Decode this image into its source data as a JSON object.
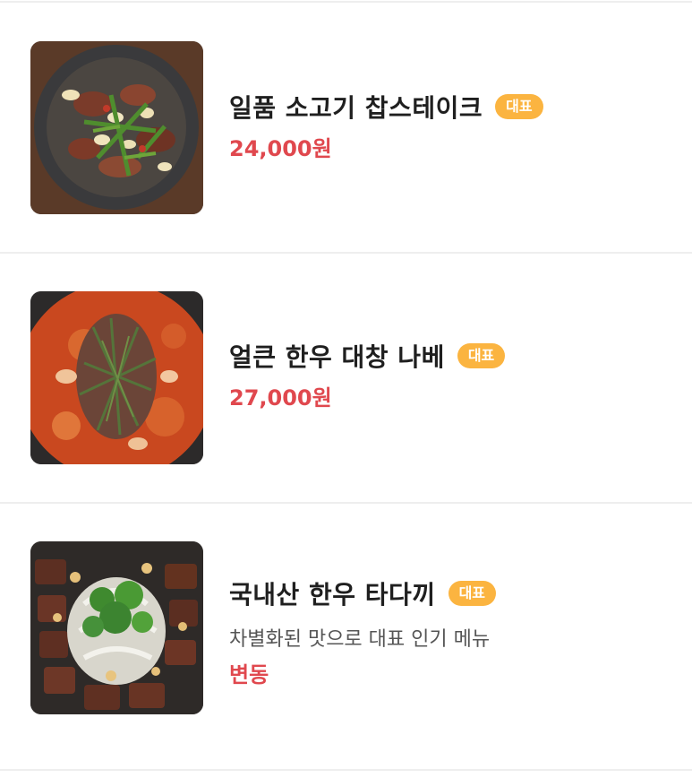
{
  "menu": {
    "items": [
      {
        "name": "일품 소고기 찹스테이크",
        "badge": "대표",
        "price": "24,000원",
        "image": "beef-chop-steak-photo"
      },
      {
        "name": "얼큰 한우 대창 나베",
        "badge": "대표",
        "price": "27,000원",
        "image": "spicy-beef-intestine-nabe-photo"
      },
      {
        "name": "국내산 한우 타다끼",
        "badge": "대표",
        "description": "차별화된 맛으로 대표 인기 메뉴",
        "price": "변동",
        "image": "korean-beef-tataki-photo"
      }
    ]
  },
  "colors": {
    "badge_bg": "#fbb440",
    "price": "#e0484e",
    "divider": "#eeeeee"
  }
}
